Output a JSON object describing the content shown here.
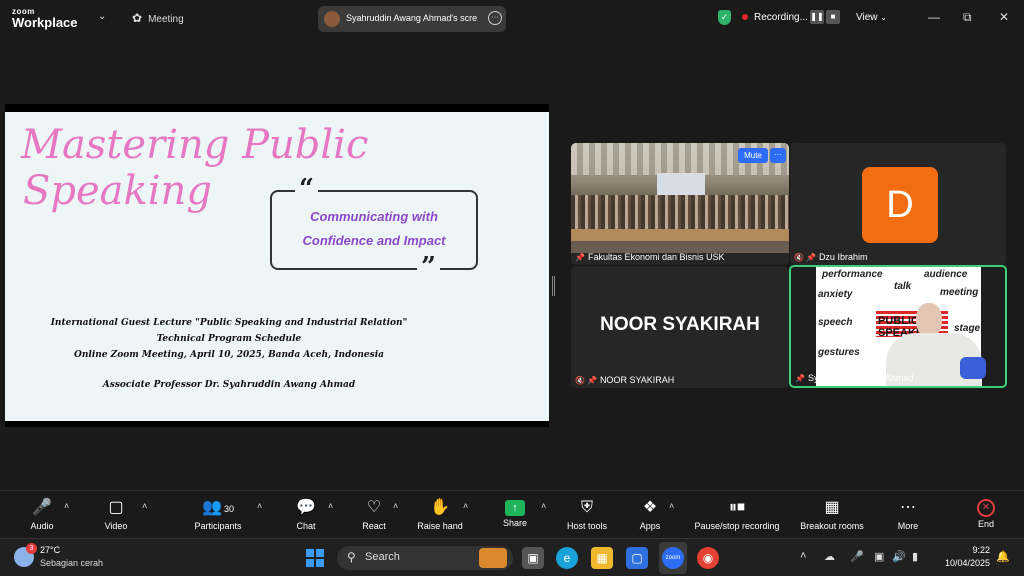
{
  "topbar": {
    "logo_line1": "zoom",
    "logo_line2": "Workplace",
    "meeting_label": "Meeting",
    "share_label": "Syahruddin Awang Ahmad's scre",
    "recording_label": "Recording...",
    "view_label": "View"
  },
  "slide": {
    "title_line1": "Mastering Public",
    "title_line2": "Speaking",
    "subtitle_line1": "Communicating with",
    "subtitle_line2": "Confidence and Impact",
    "info_line1": "International Guest Lecture \"Public Speaking and Industrial Relation\"",
    "info_line2": "Technical Program Schedule",
    "info_line3": "Online Zoom Meeting, April 10, 2025, Banda Aceh, Indonesia",
    "info_line4": "Associate Professor Dr. Syahruddin Awang Ahmad"
  },
  "tiles": {
    "t1_name": "Fakultas Ekonomi dan Bisnis USK",
    "mute_label": "Mute",
    "more_label": "···",
    "t2_initial": "D",
    "t2_name": "Dzu Ibrahim",
    "t3_big": "NOOR SYAKIRAH",
    "t3_name": "NOOR SYAKIRAH",
    "t4_name": "Syahruddin Awang Ahmad",
    "words": [
      "performance",
      "talk",
      "audience",
      "anxiety",
      "meeting",
      "speech",
      "stage",
      "gestures",
      "PUBLIC",
      "SPEAKING"
    ]
  },
  "toolbar": {
    "audio": "Audio",
    "video": "Video",
    "participants": "Participants",
    "participants_count": "30",
    "chat": "Chat",
    "react": "React",
    "raise_hand": "Raise hand",
    "share": "Share",
    "host_tools": "Host tools",
    "apps": "Apps",
    "pause_rec": "Pause/stop recording",
    "breakout": "Breakout rooms",
    "more": "More",
    "end": "End"
  },
  "taskbar": {
    "weather_badge": "3",
    "temp": "27°C",
    "weather_desc": "Sebagian cerah",
    "search": "Search",
    "time": "9:22",
    "date": "10/04/2025"
  },
  "colors": {
    "title_pink": "#e678c3",
    "subtitle_purple": "#8b49c9",
    "active_speaker_border": "#3ad17a",
    "mute_blue": "#2d6df6"
  }
}
